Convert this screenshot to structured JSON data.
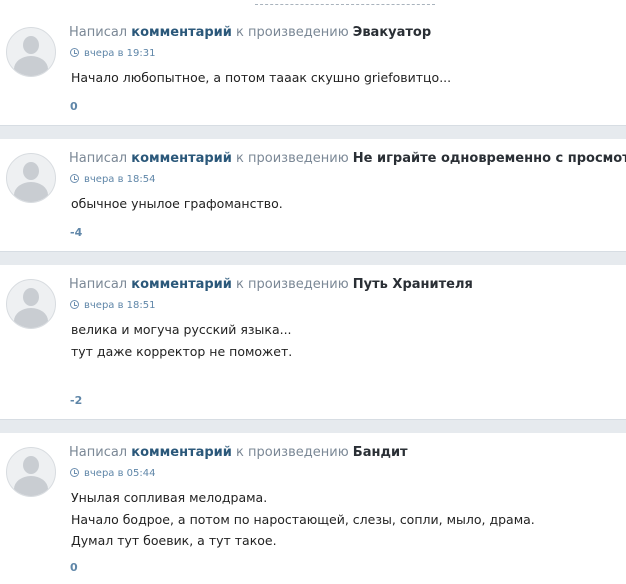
{
  "comments": [
    {
      "prefix": "Написал",
      "link": "комментарий",
      "middle": "к произведению",
      "work": "Эвакуатор",
      "time": "вчера в 19:31",
      "lines": [
        "Начало любопытное, а потом тааак скушно griefовитцо..."
      ],
      "rating": "0"
    },
    {
      "prefix": "Написал",
      "link": "комментарий",
      "middle": "к произведению",
      "work": "Не играйте одновременно с просмотро",
      "time": "вчера в 18:54",
      "lines": [
        "обычное унылое графоманство."
      ],
      "rating": "-4"
    },
    {
      "prefix": "Написал",
      "link": "комментарий",
      "middle": "к произведению",
      "work": "Путь Хранителя",
      "time": "вчера в 18:51",
      "lines": [
        "велика и могуча русский языка...",
        "тут даже корректор не поможет."
      ],
      "rating": "-2"
    },
    {
      "prefix": "Написал",
      "link": "комментарий",
      "middle": "к произведению",
      "work": "Бандит",
      "time": "вчера в 05:44",
      "lines": [
        "Унылая сопливая мелодрама.",
        "Начало бодрое, а потом по наростающей, слезы, сопли, мыло, драма.",
        "Думал тут боевик, а тут такое."
      ],
      "rating": "0"
    }
  ]
}
